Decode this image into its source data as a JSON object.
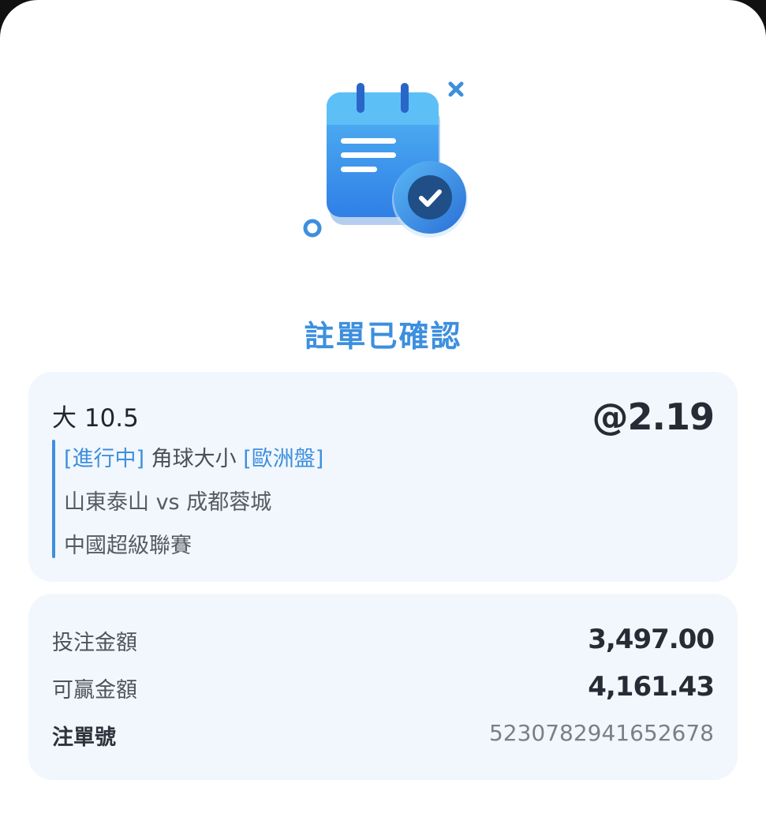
{
  "confirmation": {
    "title": "註單已確認"
  },
  "bet": {
    "selection": "大 10.5",
    "odds": "@2.19",
    "status_tag": "[進行中]",
    "market": " 角球大小 ",
    "odds_type_tag": "[歐洲盤]",
    "match": "山東泰山 vs 成都蓉城",
    "league": "中國超級聯賽"
  },
  "summary": {
    "stake_label": "投注金額",
    "stake_value": "3,497.00",
    "win_label": "可贏金額",
    "win_value": "4,161.43",
    "ticket_label": "注單號",
    "ticket_value": "5230782941652678"
  },
  "colors": {
    "accent": "#3d8fde",
    "card_bg": "#f2f7fd"
  },
  "icons": {
    "hero": "calendar-check-icon"
  }
}
